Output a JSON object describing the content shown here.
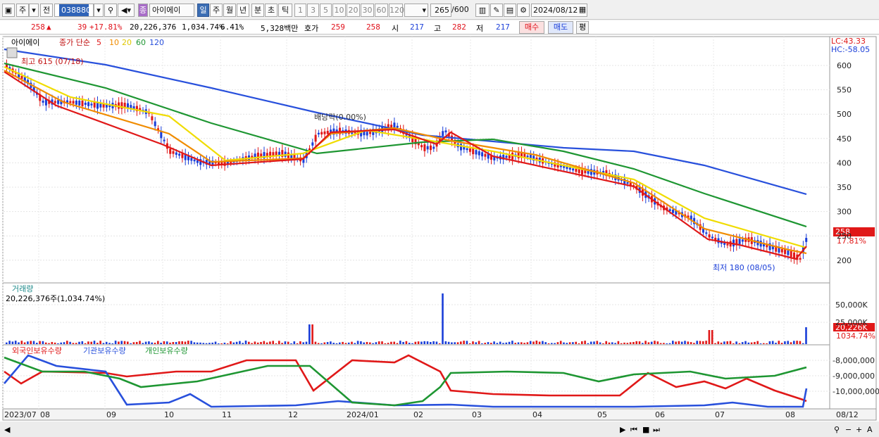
{
  "toolbar": {
    "period_unit": "주",
    "prev_label": "전",
    "code": "038880",
    "stock_name": "아이에이",
    "stock_badge": "종",
    "period_buttons": [
      "일",
      "주",
      "월",
      "년",
      "분",
      "초",
      "틱"
    ],
    "tick_buttons": [
      "1",
      "3",
      "5",
      "10",
      "20",
      "30",
      "60",
      "120"
    ],
    "view_count": "265",
    "view_total": "/600",
    "date": "2024/08/12"
  },
  "info": {
    "price": "258",
    "change": "39",
    "change_pct": "+17.81%",
    "volume": "20,226,376",
    "volume_pct": "1,034.74%",
    "turnover": "6.41%",
    "amount": "5,328백만",
    "bid_label": "호가",
    "bid1": "259",
    "bid2": "258",
    "open_label": "시",
    "open": "217",
    "high_label": "고",
    "high": "282",
    "low_label": "저",
    "low": "217",
    "buy_label": "매수",
    "sell_label": "매도",
    "eval_label": "평"
  },
  "price_panel": {
    "stock_label": "아이에이",
    "ma_label": "종가 단순",
    "ma_periods": [
      "5",
      "10",
      "20",
      "60",
      "120"
    ],
    "ma_colors": [
      "#e01818",
      "#f08c00",
      "#f0dc00",
      "#1e9632",
      "#2850dc"
    ],
    "lc": "LC:43.33",
    "hc": "HC:-58.05",
    "high_annotation": "최고 615 (07/18)",
    "low_annotation": "최저 180 (08/05)",
    "dividend_annotation": "배당락(0.00%)",
    "last_price_tag": "258",
    "last_pct_tag": "17.81%",
    "y_ticks": [
      "600",
      "550",
      "500",
      "450",
      "400",
      "350",
      "300",
      "250",
      "200"
    ]
  },
  "volume_panel": {
    "title": "거래량",
    "value": "20,226,376주(1,034.74%)",
    "y_ticks": [
      "50,000K",
      "25,000K"
    ],
    "last_tag": "20,226K",
    "last_pct": "1034.74%"
  },
  "holding_panel": {
    "series": [
      "외국인보유수량",
      "기관보유수량",
      "개인보유수량"
    ],
    "colors": [
      "#e01818",
      "#2850dc",
      "#1e9632"
    ],
    "y_ticks": [
      "-8,000,000",
      "-9,000,000",
      "-10,000,000"
    ]
  },
  "x_axis": {
    "labels": [
      "2023/07",
      "08",
      "09",
      "10",
      "11",
      "12",
      "2024/01",
      "02",
      "03",
      "04",
      "05",
      "06",
      "07",
      "08",
      "08/12"
    ]
  }
}
